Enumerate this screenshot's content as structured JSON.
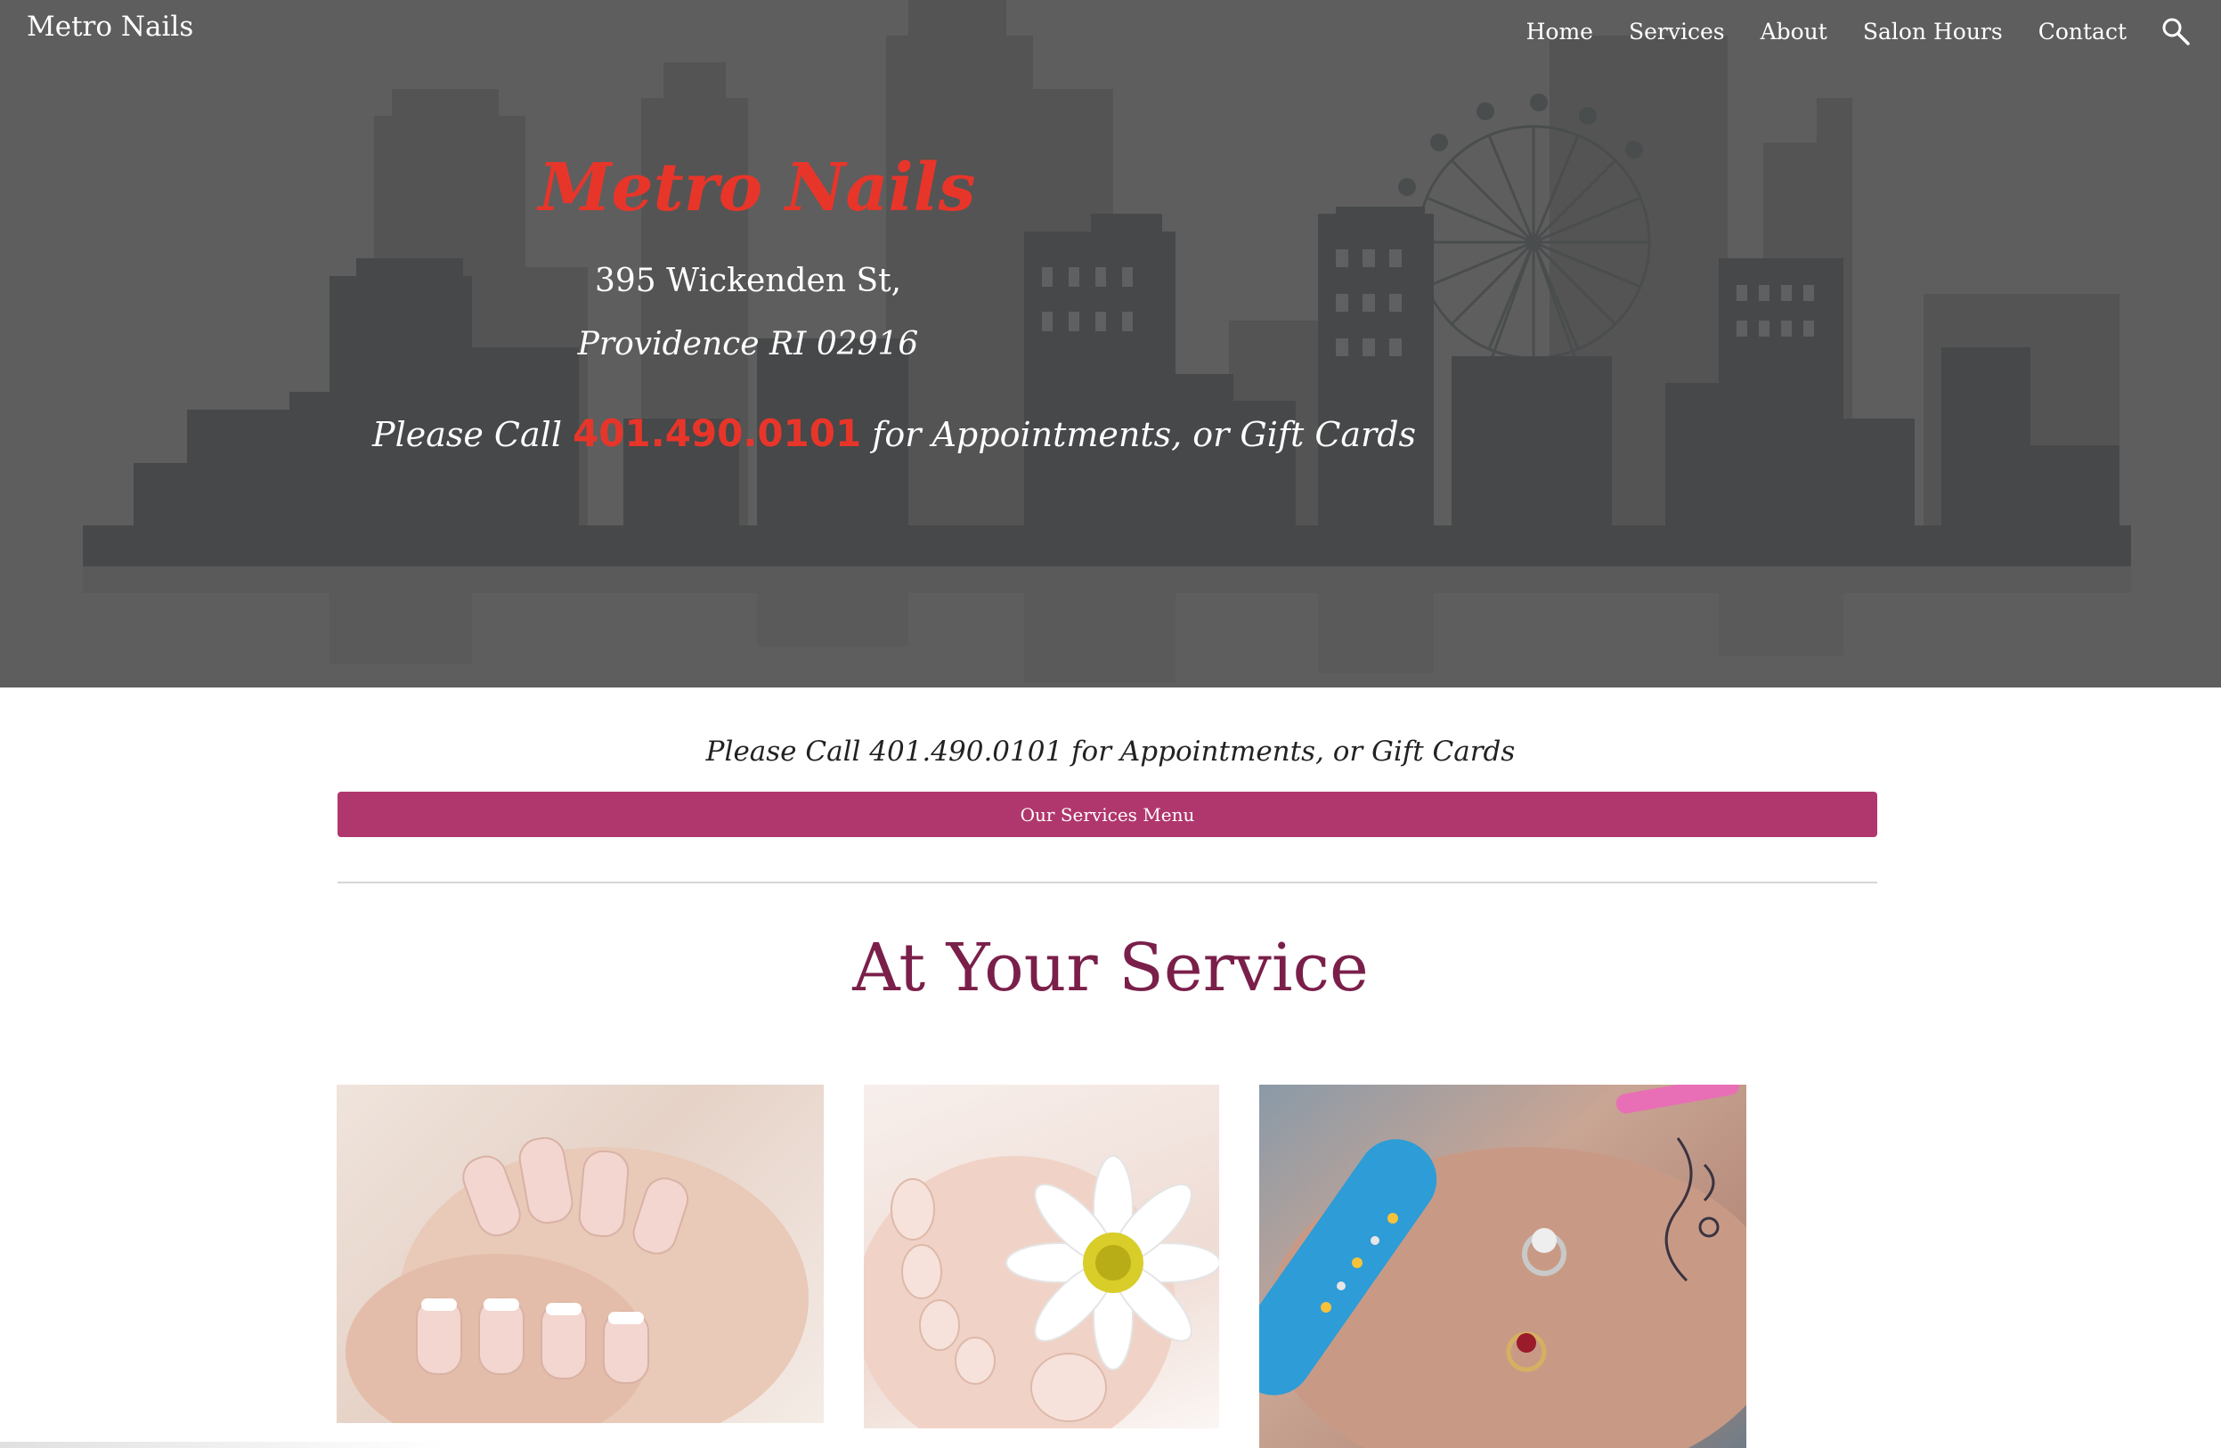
{
  "header": {
    "site_title": "Metro Nails",
    "nav": [
      {
        "label": "Home"
      },
      {
        "label": "Services"
      },
      {
        "label": "About"
      },
      {
        "label": "Salon Hours"
      },
      {
        "label": "Contact"
      }
    ],
    "search_icon": "search-icon"
  },
  "hero": {
    "title": "Metro Nails",
    "address_line1": "395 Wickenden St,",
    "address_line2": "Providence RI 02916",
    "call_prefix": "Please Call ",
    "phone": "401.490.0101",
    "call_suffix": " for Appointments, or Gift Cards"
  },
  "main": {
    "call_line": "Please Call 401.490.0101 for Appointments, or Gift Cards",
    "services_button": "Our Services Menu",
    "section_heading": "At Your Service"
  },
  "colors": {
    "hero_bg": "#5e5e5e",
    "accent_red": "#e8352a",
    "button_magenta": "#b0376d",
    "heading_plum": "#7a1f4a"
  }
}
